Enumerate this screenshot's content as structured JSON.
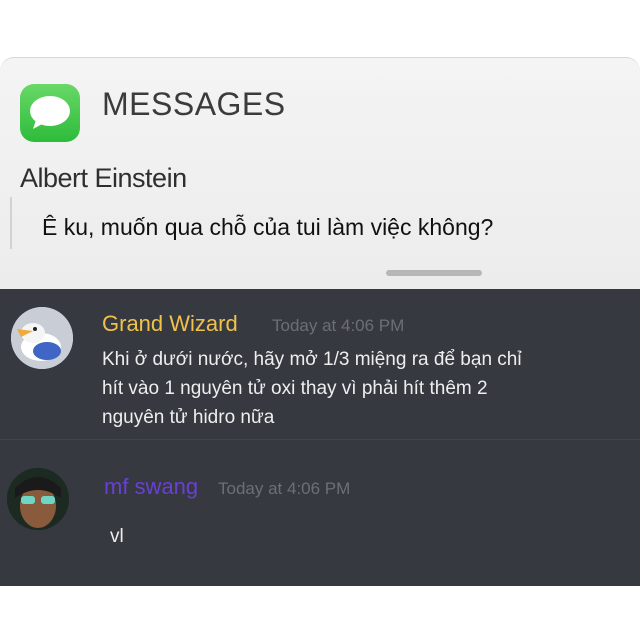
{
  "notification": {
    "app_name": "MESSAGES",
    "sender": "Albert Einstein",
    "text": "Ê ku, muốn qua chỗ của tui làm việc không?",
    "app_icon": "messages-app-icon"
  },
  "chat": {
    "messages": [
      {
        "username": "Grand Wizard",
        "timestamp": "Today at 4:06 PM",
        "lines": [
          "Khi ở dưới nước, hãy mở 1/3 miệng ra để bạn chỉ",
          "hít vào 1  nguyên  tử oxi thay vì phải hít thêm 2",
          "nguyên tử hidro nữa"
        ],
        "username_color": "#f0c24a"
      },
      {
        "username": "mf swang",
        "timestamp": "Today at 4:06 PM",
        "lines": [
          "vl"
        ],
        "username_color": "#6b3fd6"
      }
    ]
  },
  "colors": {
    "discord_bg": "#36393f",
    "notification_bg": "#f0f0f0",
    "messages_green": "#34c442"
  }
}
